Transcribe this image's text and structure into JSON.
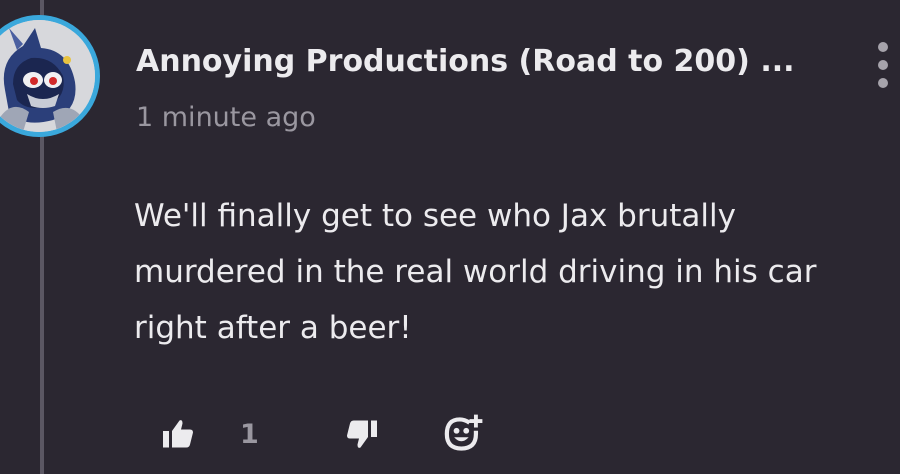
{
  "comment": {
    "author": "Annoying Productions (Road to 200) ...",
    "timestamp": "1 minute ago",
    "body_lines": [
      "We'll finally get to see who Jax brutally",
      "murdered in the real world driving in his car",
      "right after a beer!"
    ],
    "like_count": "1"
  },
  "icons": {
    "avatar": "metal-sonic-avatar",
    "more": "vertical-ellipsis-icon",
    "like": "thumbs-up-icon",
    "dislike": "thumbs-down-icon",
    "react": "add-reaction-icon"
  },
  "colors": {
    "background": "#2b2731",
    "text_primary": "#ecebee",
    "text_secondary": "#9a97a0",
    "avatar_ring": "#3aa8dc",
    "thread_line": "#5b5763"
  }
}
